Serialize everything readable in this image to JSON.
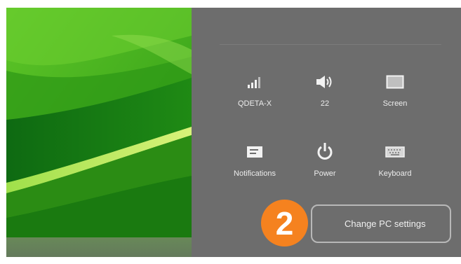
{
  "settings_panel": {
    "tiles": [
      {
        "label": "QDETA-X",
        "icon": "wifi-signal-icon"
      },
      {
        "label": "22",
        "icon": "volume-icon"
      },
      {
        "label": "Screen",
        "icon": "screen-brightness-icon"
      },
      {
        "label": "Notifications",
        "icon": "notifications-icon"
      },
      {
        "label": "Power",
        "icon": "power-icon"
      },
      {
        "label": "Keyboard",
        "icon": "keyboard-icon"
      }
    ],
    "change_pc_settings_label": "Change PC settings"
  },
  "step_badge": {
    "number": "2",
    "color": "#f5821f"
  },
  "colors": {
    "panel_background": "#6d6d6d",
    "wallpaper_green": "#3fae1c",
    "highlight_outline": "#b8b8b8"
  }
}
